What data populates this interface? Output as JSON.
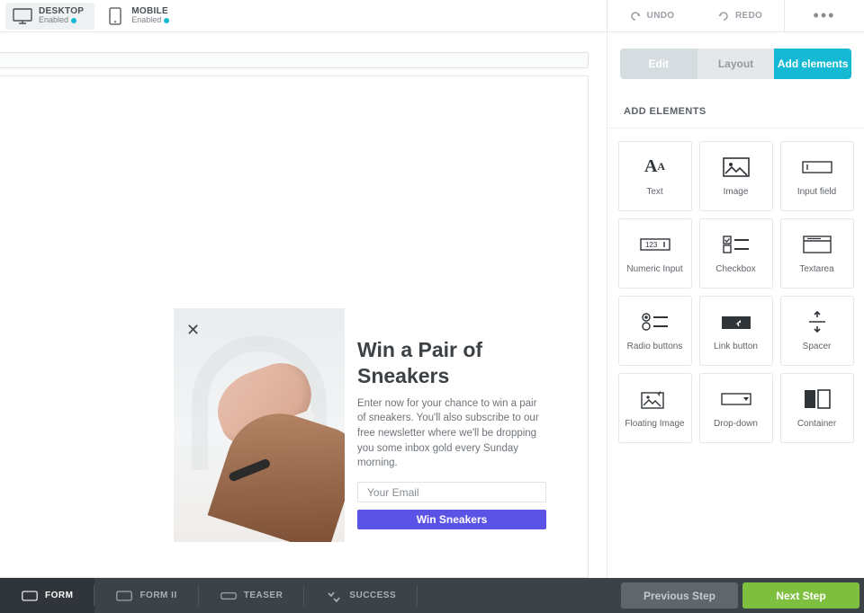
{
  "topbar": {
    "devices": [
      {
        "name": "DESKTOP",
        "status": "Enabled",
        "active": true
      },
      {
        "name": "MOBILE",
        "status": "Enabled",
        "active": false
      }
    ],
    "undo": "UNDO",
    "redo": "REDO"
  },
  "panel": {
    "tabs": {
      "edit": "Edit",
      "layout": "Layout",
      "add": "Add elements"
    },
    "section_title": "ADD ELEMENTS",
    "elements": [
      {
        "id": "text",
        "label": "Text"
      },
      {
        "id": "image",
        "label": "Image"
      },
      {
        "id": "input",
        "label": "Input field"
      },
      {
        "id": "numeric",
        "label": "Numeric Input"
      },
      {
        "id": "checkbox",
        "label": "Checkbox"
      },
      {
        "id": "textarea",
        "label": "Textarea"
      },
      {
        "id": "radio",
        "label": "Radio buttons"
      },
      {
        "id": "linkbutton",
        "label": "Link button"
      },
      {
        "id": "spacer",
        "label": "Spacer"
      },
      {
        "id": "floatimage",
        "label": "Floating Image"
      },
      {
        "id": "dropdown",
        "label": "Drop-down"
      },
      {
        "id": "container",
        "label": "Container"
      }
    ]
  },
  "popup": {
    "title": "Win a Pair of Sneakers",
    "desc": "Enter now for your chance to win a pair of sneakers. You'll also subscribe to our free newsletter where we'll be dropping you some inbox gold every Sunday morning.",
    "email_placeholder": "Your Email",
    "cta": "Win Sneakers"
  },
  "bottombar": {
    "steps": [
      {
        "id": "form",
        "label": "FORM",
        "active": true
      },
      {
        "id": "form2",
        "label": "FORM II",
        "active": false
      },
      {
        "id": "teaser",
        "label": "TEASER",
        "active": false
      },
      {
        "id": "success",
        "label": "SUCCESS",
        "active": false
      }
    ],
    "prev": "Previous Step",
    "next": "Next Step"
  }
}
